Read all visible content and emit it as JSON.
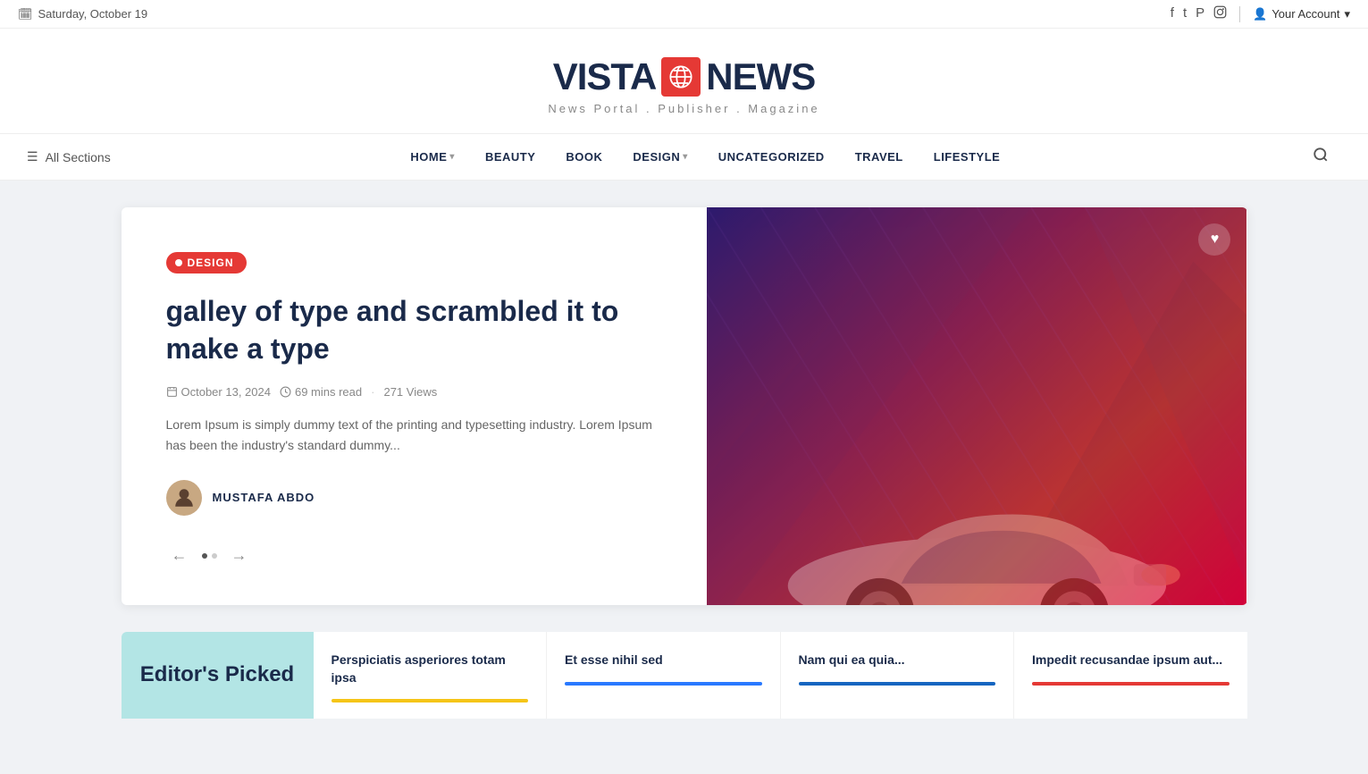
{
  "topbar": {
    "date": "Saturday, October 19",
    "social": [
      "f",
      "t",
      "p",
      "i"
    ],
    "account_label": "Your Account"
  },
  "header": {
    "logo_vista": "VISTA",
    "logo_news": "NEWS",
    "tagline": "News Portal  .  Publisher  .  Magazine"
  },
  "nav": {
    "all_sections": "All Sections",
    "items": [
      {
        "label": "HOME",
        "has_dropdown": true
      },
      {
        "label": "BEAUTY",
        "has_dropdown": false
      },
      {
        "label": "BOOK",
        "has_dropdown": false
      },
      {
        "label": "DESIGN",
        "has_dropdown": true
      },
      {
        "label": "UNCATEGORIZED",
        "has_dropdown": false
      },
      {
        "label": "TRAVEL",
        "has_dropdown": false
      },
      {
        "label": "LIFESTYLE",
        "has_dropdown": false
      }
    ]
  },
  "featured": {
    "category": "DESIGN",
    "title": "galley of type and scrambled it to make a type",
    "date": "October 13, 2024",
    "read_time": "69 mins read",
    "views": "271 Views",
    "excerpt": "Lorem Ipsum is simply dummy text of the printing and typesetting industry. Lorem Ipsum has been the industry's standard dummy...",
    "author_name": "MUSTAFA ABDO"
  },
  "editors_picked": {
    "section_title": "Editor's Picked",
    "items": [
      {
        "title": "Perspiciatis asperiores totam ipsa",
        "bar_color": "bar-yellow"
      },
      {
        "title": "Et esse nihil sed",
        "bar_color": "bar-blue"
      },
      {
        "title": "Nam qui ea quia...",
        "bar_color": "bar-blue2"
      },
      {
        "title": "Impedit recusandae ipsum aut...",
        "bar_color": "bar-red"
      }
    ]
  },
  "icons": {
    "hamburger": "☰",
    "search": "🔍",
    "chevron_down": "▾",
    "arrow_left": "←",
    "arrow_right": "→",
    "heart": "♥",
    "calendar": "📅",
    "clock": "🕐",
    "user": "👤"
  }
}
